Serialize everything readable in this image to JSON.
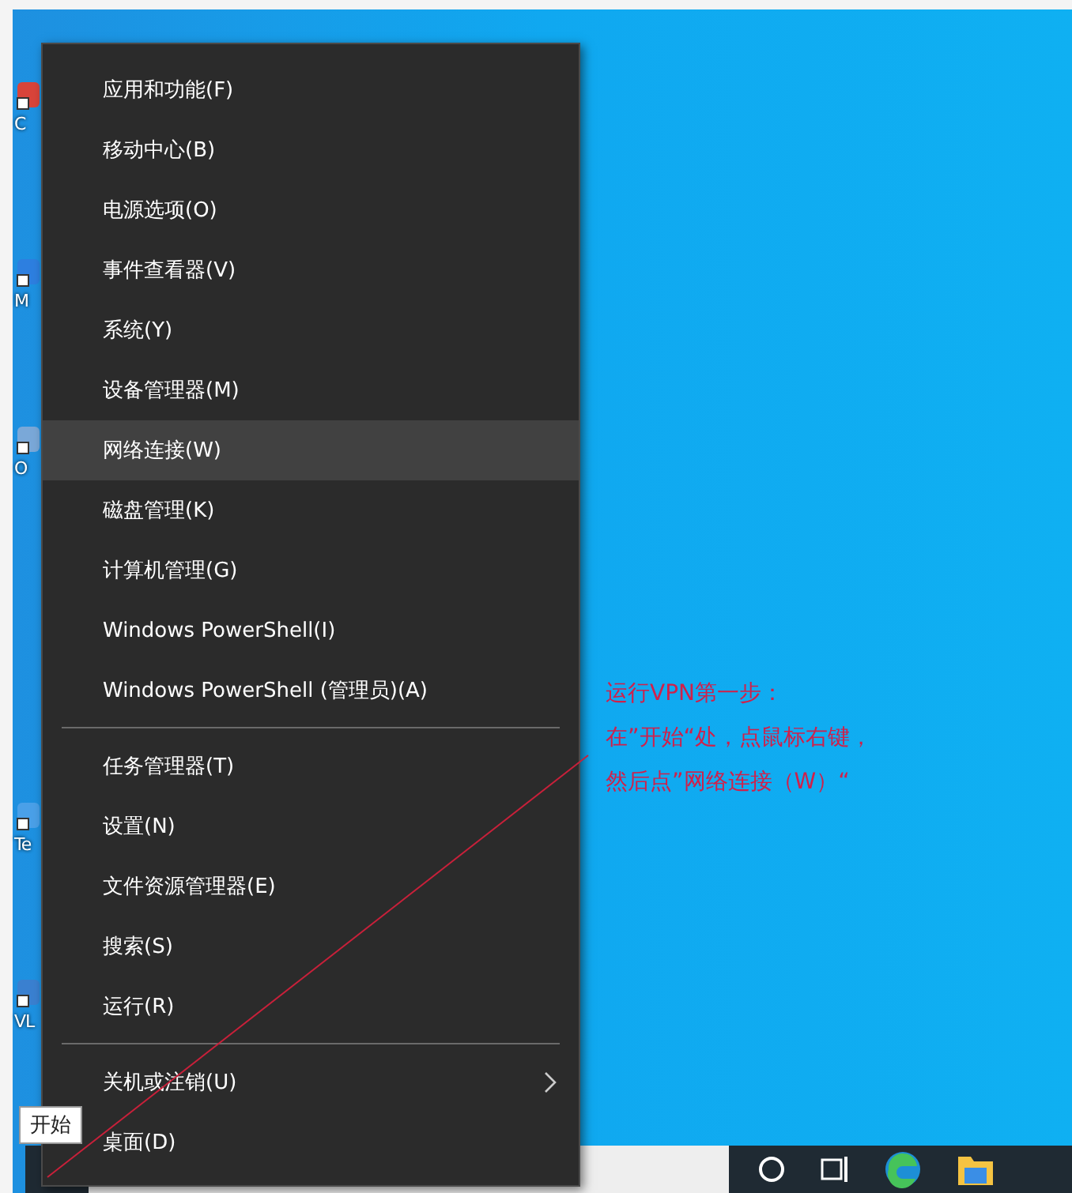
{
  "desktop_icons": [
    {
      "label": "C"
    },
    {
      "label": "M"
    },
    {
      "label": "O"
    },
    {
      "label": "Te"
    },
    {
      "label": "VL"
    }
  ],
  "context_menu": {
    "sections": [
      [
        {
          "label": "应用和功能(F)",
          "selected": false,
          "submenu": false
        },
        {
          "label": "移动中心(B)",
          "selected": false,
          "submenu": false
        },
        {
          "label": "电源选项(O)",
          "selected": false,
          "submenu": false
        },
        {
          "label": "事件查看器(V)",
          "selected": false,
          "submenu": false
        },
        {
          "label": "系统(Y)",
          "selected": false,
          "submenu": false
        },
        {
          "label": "设备管理器(M)",
          "selected": false,
          "submenu": false
        },
        {
          "label": "网络连接(W)",
          "selected": true,
          "submenu": false
        },
        {
          "label": "磁盘管理(K)",
          "selected": false,
          "submenu": false
        },
        {
          "label": "计算机管理(G)",
          "selected": false,
          "submenu": false
        },
        {
          "label": "Windows PowerShell(I)",
          "selected": false,
          "submenu": false
        },
        {
          "label": "Windows PowerShell (管理员)(A)",
          "selected": false,
          "submenu": false
        }
      ],
      [
        {
          "label": "任务管理器(T)",
          "selected": false,
          "submenu": false
        },
        {
          "label": "设置(N)",
          "selected": false,
          "submenu": false
        },
        {
          "label": "文件资源管理器(E)",
          "selected": false,
          "submenu": false
        },
        {
          "label": "搜索(S)",
          "selected": false,
          "submenu": false
        },
        {
          "label": "运行(R)",
          "selected": false,
          "submenu": false
        }
      ],
      [
        {
          "label": "关机或注销(U)",
          "selected": false,
          "submenu": true
        },
        {
          "label": "桌面(D)",
          "selected": false,
          "submenu": false
        }
      ]
    ]
  },
  "annotation": {
    "lines": [
      "运行VPN第一步：",
      "在”开始“处，点鼠标右键，",
      "然后点”网络连接（W）“"
    ]
  },
  "tooltip": "开始"
}
